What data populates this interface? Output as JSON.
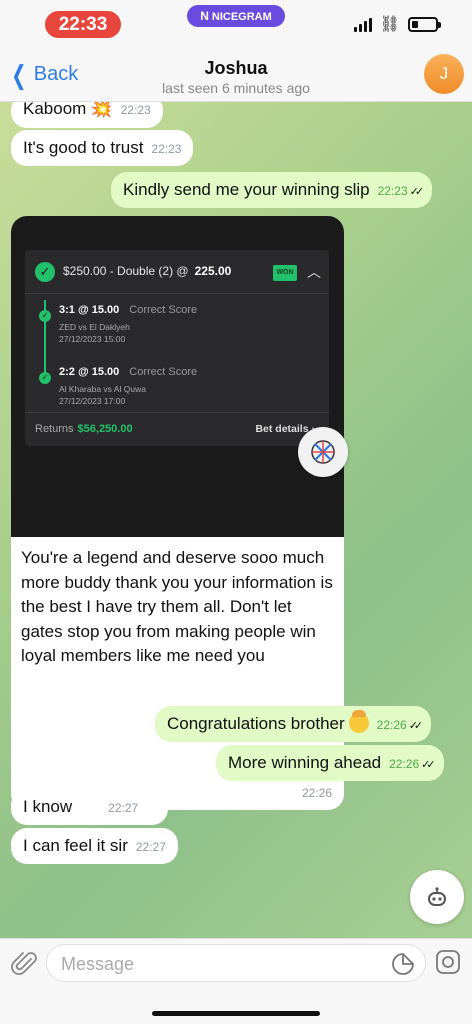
{
  "status": {
    "time": "22:33",
    "app_name": "NICEGRAM",
    "app_logo": "N"
  },
  "nav": {
    "back_label": "Back",
    "title": "Joshua",
    "subtitle": "last seen 6 minutes ago",
    "avatar_initial": "J",
    "avatar_color": "#f39c3a"
  },
  "messages": [
    {
      "dir": "in",
      "text": "Kaboom",
      "time": "22:23"
    },
    {
      "dir": "in",
      "text": "It's good to trust",
      "time": "22:23"
    },
    {
      "dir": "out",
      "text": "Kindly send me your winning slip",
      "time": "22:23"
    },
    {
      "dir": "in",
      "caption": "You're a legend and deserve sooo much more buddy thank you your information is the best I have try them all. Don't let gates stop you from making people win loyal members like me need you",
      "time": "22:26"
    },
    {
      "dir": "out",
      "text": "Congratulations brother",
      "time": "22:26"
    },
    {
      "dir": "out",
      "text": "More winning ahead",
      "time": "22:26"
    },
    {
      "dir": "in",
      "text": "I know",
      "time": "22:27"
    },
    {
      "dir": "in",
      "text": "I can feel it sir",
      "time": "22:27"
    }
  ],
  "slip": {
    "stake_line": "$250.00 - Double (2) @",
    "total_odds": "225.00",
    "badge": "WON",
    "legs": [
      {
        "pick": "3:1",
        "odds": "@ 15.00",
        "market": "Correct Score",
        "match": "ZED vs El Daklyeh",
        "datetime": "27/12/2023 15:00"
      },
      {
        "pick": "2:2",
        "odds": "@ 15.00",
        "market": "Correct Score",
        "match": "Al Kharaba vs Al Quwa",
        "datetime": "27/12/2023 17:00"
      }
    ],
    "returns_label": "Returns",
    "returns_value": "$56,250.00",
    "bet_details": "Bet details"
  },
  "input": {
    "placeholder": "Message"
  },
  "colors": {
    "accent": "#2f7ee8",
    "outgoing_bubble": "#e2fac6",
    "won_green": "#21c16b",
    "time_pill": "#e8453c",
    "app_pill": "#6a4be0"
  }
}
